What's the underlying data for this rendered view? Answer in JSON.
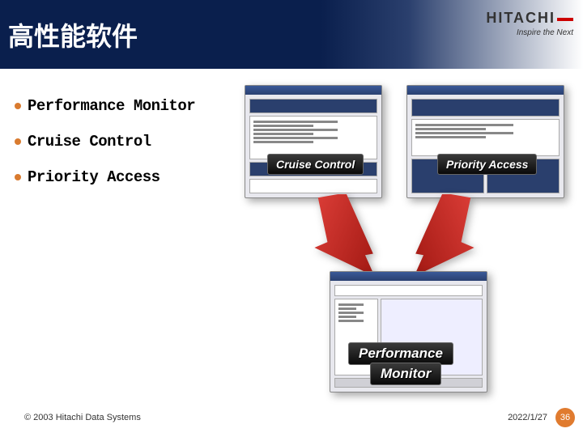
{
  "header": {
    "title": "高性能软件",
    "logo": "HITACHI",
    "tagline": "Inspire the Next"
  },
  "bullets": [
    "Performance Monitor",
    "Cruise Control",
    "Priority Access"
  ],
  "badges": {
    "cc": "Cruise Control",
    "pa": "Priority Access",
    "pm1": "Performance",
    "pm2": "Monitor"
  },
  "footer": {
    "copyright": "© 2003 Hitachi Data Systems",
    "date": "2022/1/27",
    "page": "36"
  }
}
